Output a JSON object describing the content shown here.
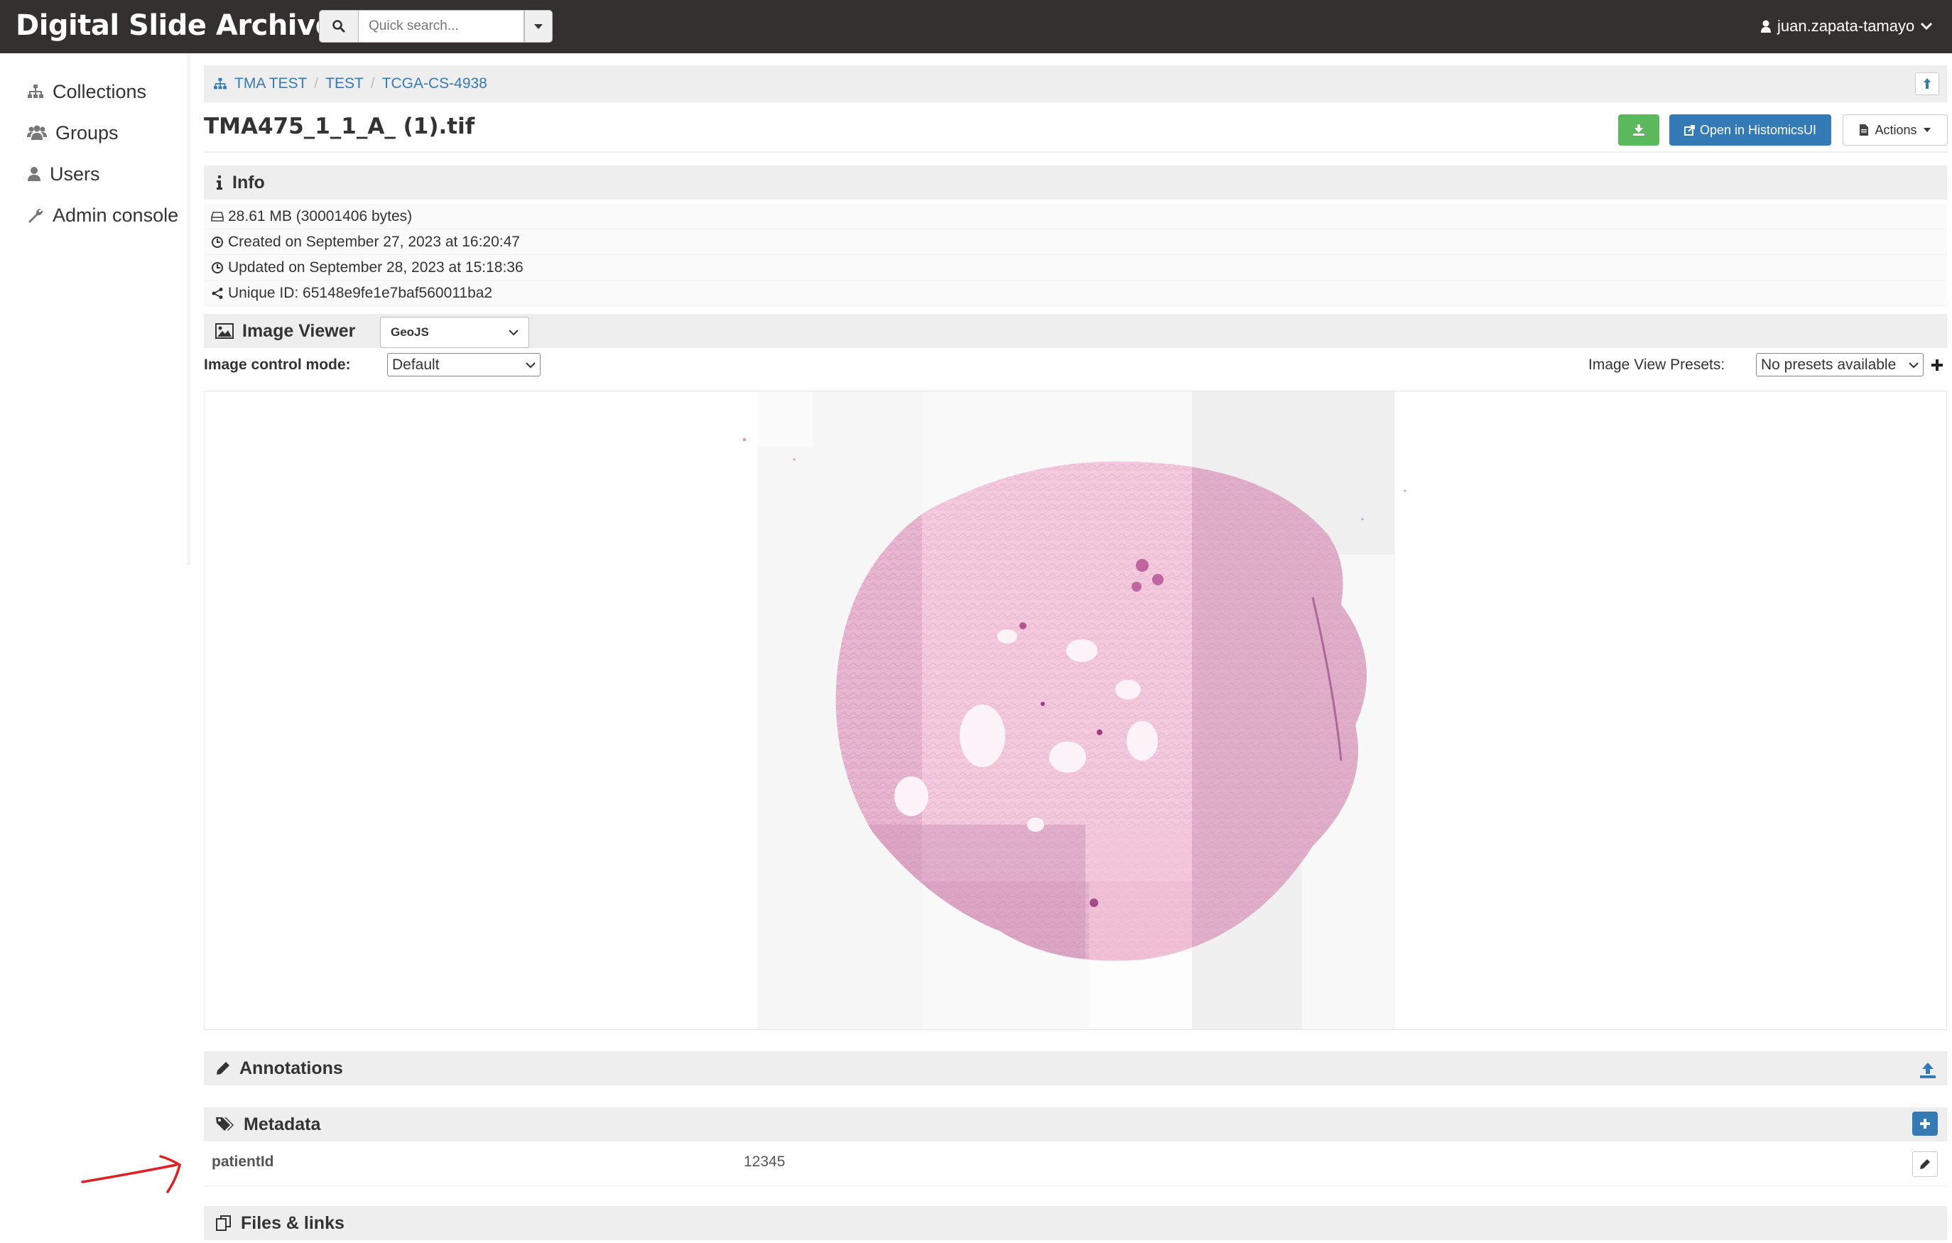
{
  "app": {
    "brand": "Digital Slide Archive"
  },
  "search": {
    "placeholder": "Quick search..."
  },
  "user": {
    "name": "juan.zapata-tamayo"
  },
  "sidebar": {
    "items": [
      {
        "label": "Collections",
        "icon": "sitemap-icon"
      },
      {
        "label": "Groups",
        "icon": "users-icon"
      },
      {
        "label": "Users",
        "icon": "user-icon"
      },
      {
        "label": "Admin console",
        "icon": "wrench-icon"
      }
    ]
  },
  "breadcrumb": {
    "items": [
      "TMA TEST",
      "TEST",
      "TCGA-CS-4938"
    ]
  },
  "item": {
    "title": "TMA475_1_1_A_ (1).tif",
    "open_label": "Open in HistomicsUI",
    "actions_label": "Actions"
  },
  "info": {
    "heading": "Info",
    "size": "28.61 MB (30001406 bytes)",
    "created": "Created on September 27, 2023 at 16:20:47",
    "updated": "Updated on September 28, 2023 at 15:18:36",
    "unique_id": "Unique ID: 65148e9fe1e7baf560011ba2"
  },
  "viewer": {
    "heading": "Image Viewer",
    "selected": "GeoJS",
    "control_label": "Image control mode:",
    "control_value": "Default",
    "presets_label": "Image View Presets:",
    "presets_value": "No presets available"
  },
  "annotations": {
    "heading": "Annotations"
  },
  "metadata": {
    "heading": "Metadata",
    "rows": [
      {
        "key": "patientId",
        "value": "12345"
      }
    ]
  },
  "files": {
    "heading": "Files & links"
  },
  "colors": {
    "topbar": "#333130",
    "link": "#337ab7",
    "success": "#5cb85c",
    "panel": "#eeeeee",
    "annotation_arrow": "#e02020"
  }
}
